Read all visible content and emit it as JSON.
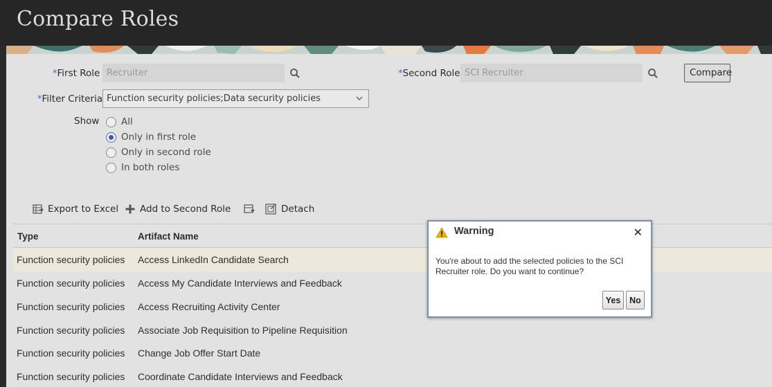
{
  "page": {
    "title": "Compare Roles"
  },
  "form": {
    "required_marker": "*",
    "first_role": {
      "label": "First Role",
      "value": "Recruiter"
    },
    "second_role": {
      "label": "Second Role",
      "value": "SCI Recruiter"
    },
    "compare_button": "Compare",
    "filter_criteria": {
      "label": "Filter Criteria",
      "value": "Function security policies;Data security policies"
    },
    "show": {
      "label": "Show",
      "options": [
        "All",
        "Only in first role",
        "Only in second role",
        "In both roles"
      ],
      "selected": "Only in first role"
    }
  },
  "toolbar": {
    "export": "Export to Excel",
    "add": "Add to Second Role",
    "detach": "Detach"
  },
  "table": {
    "columns": [
      "Type",
      "Artifact Name"
    ],
    "rows": [
      [
        "Function security policies",
        "Access LinkedIn Candidate Search"
      ],
      [
        "Function security policies",
        "Access My Candidate Interviews and Feedback"
      ],
      [
        "Function security policies",
        "Access Recruiting Activity Center"
      ],
      [
        "Function security policies",
        "Associate Job Requisition to Pipeline Requisition"
      ],
      [
        "Function security policies",
        "Change Job Offer Start Date"
      ],
      [
        "Function security policies",
        "Coordinate Candidate Interviews and Feedback"
      ]
    ]
  },
  "dialog": {
    "title": "Warning",
    "message": "You're about to add the selected policies to the SCI Recruiter role. Do you want to continue?",
    "yes": "Yes",
    "no": "No"
  },
  "colors": {
    "header_bg": "#262626",
    "panel_bg": "#e2e2e2",
    "required_marker": "#3a70b3",
    "selected_row": "#ebe7da",
    "warning_icon": "#f0b000"
  }
}
